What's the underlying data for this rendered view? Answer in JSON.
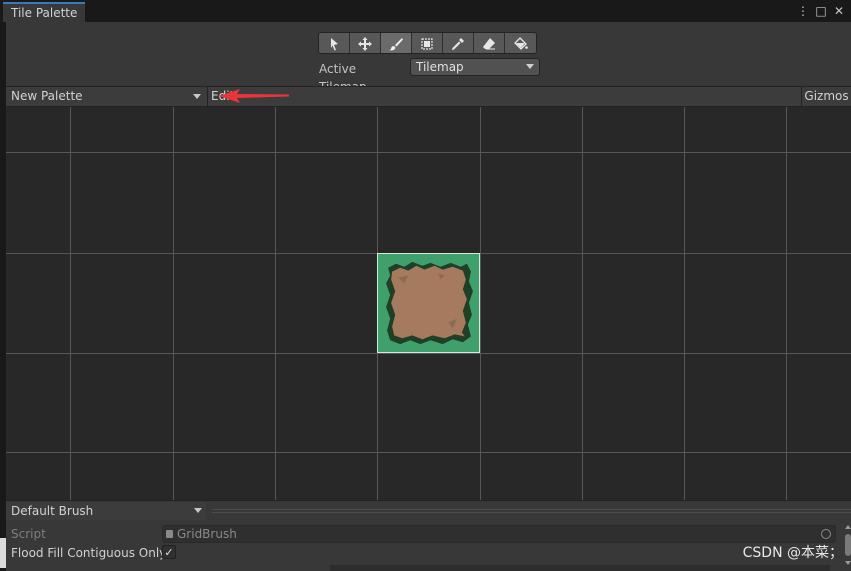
{
  "window": {
    "tab_title": "Tile Palette",
    "icons": [
      "kebab-menu-icon",
      "maximize-icon",
      "close-icon"
    ],
    "icon_glyphs": [
      "⋮",
      "□",
      "✕"
    ]
  },
  "toolbar": {
    "tools": [
      "select-tool-icon",
      "move-tool-icon",
      "paint-brush-tool-icon",
      "box-fill-tool-icon",
      "picker-tool-icon",
      "eraser-tool-icon",
      "flood-fill-tool-icon"
    ],
    "active_tool": "paint-brush-tool-icon",
    "active_tilemap_label": "Active Tilemap",
    "active_tilemap_value": "Tilemap"
  },
  "palette_bar": {
    "palette_name": "New Palette",
    "edit_label": "Edit",
    "gizmos_label": "Gizmos"
  },
  "brush": {
    "brush_name": "Default Brush",
    "script_label": "Script",
    "script_value": "GridBrush",
    "flood_fill_label": "Flood Fill Contiguous Only",
    "flood_fill_checked": "✓"
  },
  "watermark": "CSDN @本菜；",
  "colors": {
    "accent_tab": "#3a79bb",
    "annotation_arrow": "#e8343a",
    "tile_grass": "#3fa06b",
    "tile_dirt": "#a57a5e"
  }
}
